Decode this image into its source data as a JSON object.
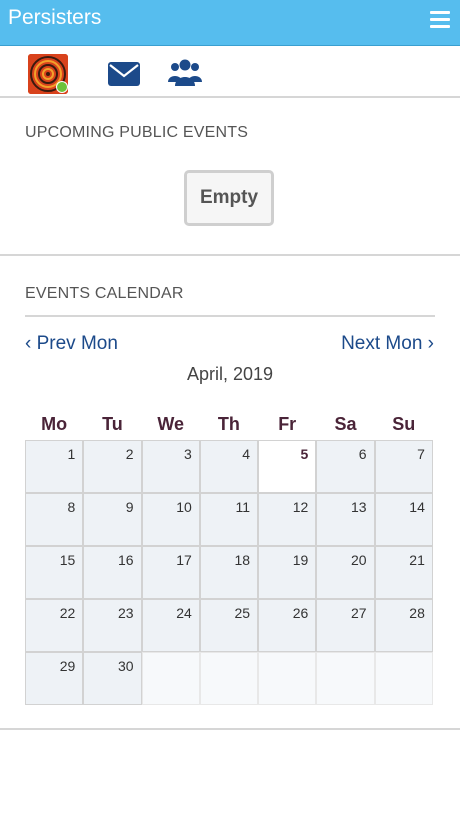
{
  "app": {
    "title": "Persisters"
  },
  "icons": {
    "menu": "hamburger-menu-icon",
    "mail": "envelope-icon",
    "group": "users-group-icon",
    "avatar": "user-avatar"
  },
  "colors": {
    "topbar": "#56bdee",
    "link": "#1c4a8a",
    "online": "#6cc23a",
    "calendar_cell": "#eef2f6"
  },
  "upcoming": {
    "heading": "UPCOMING PUBLIC EVENTS",
    "empty_label": "Empty"
  },
  "calendar": {
    "heading": "EVENTS CALENDAR",
    "prev_label": "‹ Prev Mon",
    "next_label": "Next Mon ›",
    "month_label": "April, 2019",
    "weekdays": [
      "Mo",
      "Tu",
      "We",
      "Th",
      "Fr",
      "Sa",
      "Su"
    ],
    "today": "5",
    "weeks": [
      [
        "1",
        "2",
        "3",
        "4",
        "5",
        "6",
        "7"
      ],
      [
        "8",
        "9",
        "10",
        "11",
        "12",
        "13",
        "14"
      ],
      [
        "15",
        "16",
        "17",
        "18",
        "19",
        "20",
        "21"
      ],
      [
        "22",
        "23",
        "24",
        "25",
        "26",
        "27",
        "28"
      ],
      [
        "29",
        "30",
        "",
        "",
        "",
        "",
        ""
      ]
    ]
  }
}
